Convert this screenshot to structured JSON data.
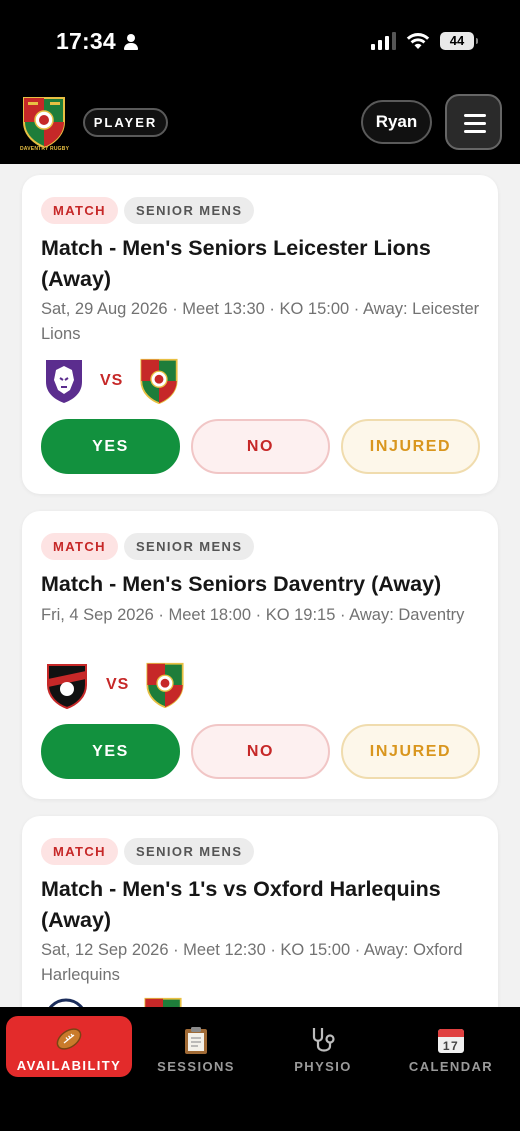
{
  "status_bar": {
    "time": "17:34",
    "battery": "44"
  },
  "header": {
    "logo_caption": "DAVENTRY RUGBY",
    "role": "PLAYER",
    "user": "Ryan"
  },
  "fixtures": [
    {
      "tag_type": "MATCH",
      "tag_team": "SENIOR MENS",
      "title": "Match - Men's Seniors Leicester Lions (Away)",
      "meta": "Sat, 29 Aug 2026 · Meet 13:30 · KO 15:00 · Away: Leicester Lions",
      "vs": "VS",
      "yes": "YES",
      "no": "NO",
      "injured": "INJURED"
    },
    {
      "tag_type": "MATCH",
      "tag_team": "SENIOR MENS",
      "title": "Match - Men's Seniors Daventry (Away)",
      "meta": "Fri, 4 Sep 2026 · Meet 18:00 · KO 19:15 · Away: Daventry",
      "vs": "VS",
      "yes": "YES",
      "no": "NO",
      "injured": "INJURED"
    },
    {
      "tag_type": "MATCH",
      "tag_team": "SENIOR MENS",
      "title": "Match - Men's 1's vs Oxford Harlequins (Away)",
      "meta": "Sat, 12 Sep 2026 · Meet 12:30 · KO 15:00 · Away: Oxford Harlequins",
      "vs": "VS"
    }
  ],
  "nav": {
    "availability": "AVAILABILITY",
    "sessions": "SESSIONS",
    "physio": "PHYSIO",
    "calendar": "CALENDAR",
    "calendar_day": "17"
  },
  "colors": {
    "brand_red": "#c62828",
    "accent_green": "#12913e",
    "injured_amber": "#d9961e",
    "nav_active": "#e32b2b"
  }
}
